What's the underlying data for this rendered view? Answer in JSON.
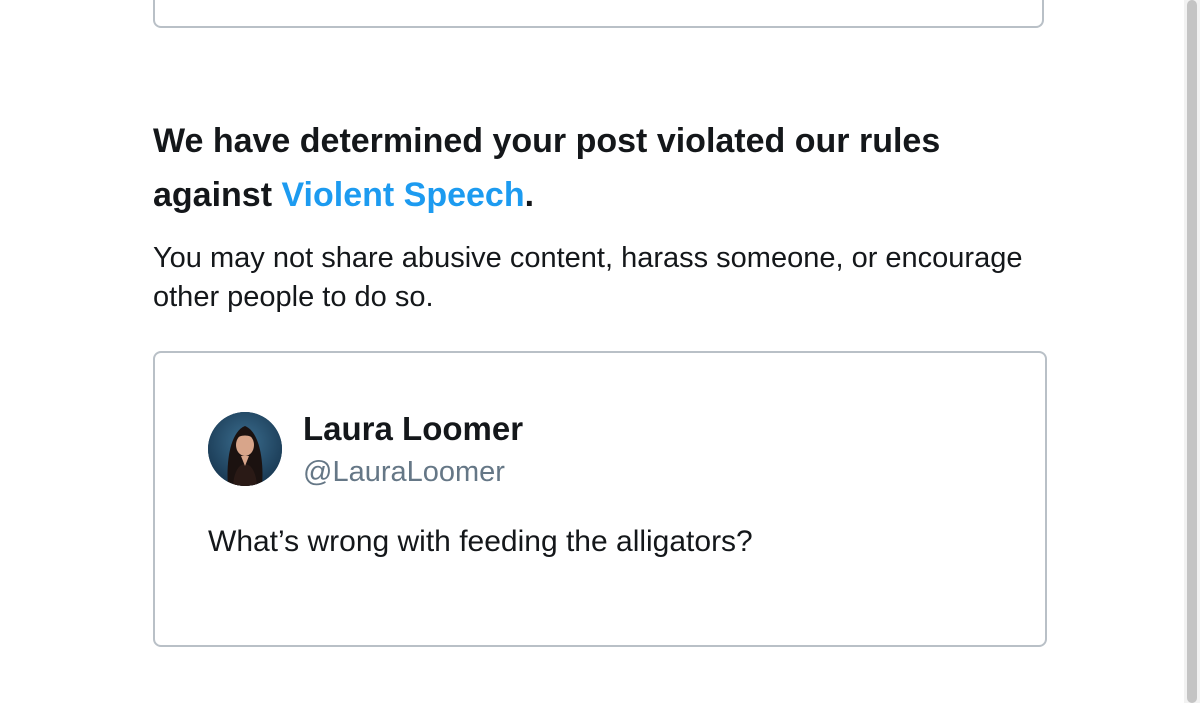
{
  "notice": {
    "heading_prefix": "We have determined your post violated our rules against ",
    "rule_link": "Violent Speech",
    "heading_suffix": ".",
    "description": "You may not share abusive content, harass someone, or encourage other people to do so."
  },
  "tweet": {
    "author_name": "Laura Loomer",
    "author_handle": "@LauraLoomer",
    "text": "What’s wrong with feeding the alligators?"
  },
  "colors": {
    "link": "#1d9bf0",
    "text": "#14171a",
    "muted": "#657786",
    "border": "#b9c0c7"
  }
}
